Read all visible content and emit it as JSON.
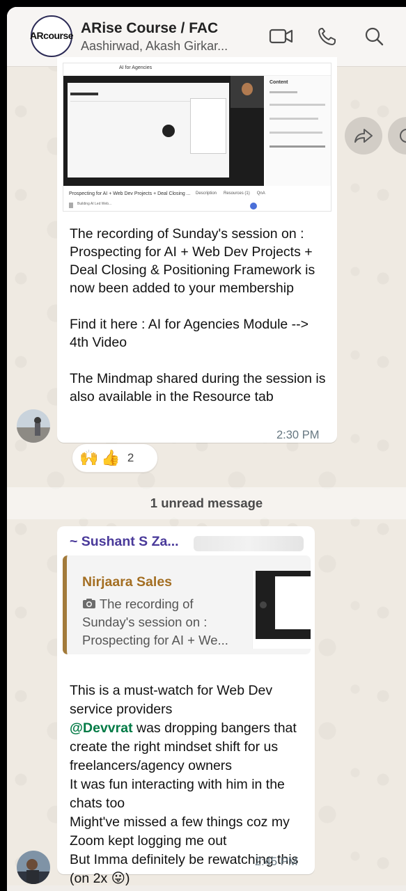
{
  "header": {
    "title": "ARise Course / FAC",
    "subtitle": "Aashirwad, Akash Girkar...",
    "logo_text": "ARcourse"
  },
  "message1": {
    "media_header": "AI for Agencies",
    "video_caption": "Prospecting for AI + Web Dev Projects + Deal Closing ...",
    "video_tabs": [
      "Description",
      "Resources (1)",
      "QnA"
    ],
    "content_panel_title": "Content",
    "attachment_name": "Building AI Led Web...",
    "text": "The recording of Sunday's session on : Prospecting for AI + Web Dev Projects + Deal Closing & Positioning Framework is now been added to your membership\n\nFind it here : AI for Agencies Module --> 4th Video\n\nThe Mindmap shared during the session is also available in the Resource tab",
    "time": "2:30 PM",
    "reactions": {
      "emojis": [
        "🙌",
        "👍"
      ],
      "count": "2"
    }
  },
  "unread_label": "1 unread message",
  "message2": {
    "sender": "~ Sushant S Za...",
    "quote": {
      "author": "Nirjaara Sales",
      "text": "The recording of Sunday's session on : Prospecting for AI + We..."
    },
    "text_before_mention": "This is a must-watch for Web Dev service providers",
    "mention": "@Devvrat",
    "text_after_mention": " was dropping bangers that create the right mindset shift for us freelancers/agency owners\nIt was fun interacting with him in the chats too\nMight've missed a few things coz my Zoom kept logging me out\nBut Imma definitely be rewatching this (on 2x 😛)",
    "time": "2:45 PM"
  },
  "icons": {
    "video_call": "video-camera-icon",
    "voice_call": "phone-icon",
    "search": "search-icon",
    "forward": "forward-icon",
    "quote_camera": "camera-icon"
  },
  "colors": {
    "sender_name": "#4a3a9a",
    "quote_author": "#a36e22",
    "quote_bar": "#a37b3b",
    "mention": "#027a45",
    "chat_bg": "#efeae2",
    "time": "#667781"
  }
}
